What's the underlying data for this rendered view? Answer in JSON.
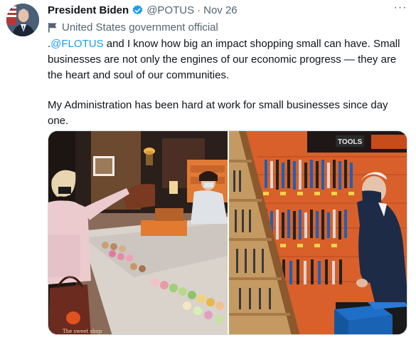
{
  "author": {
    "name": "President Biden",
    "handle": "@POTUS",
    "separator": "·",
    "date": "Nov 26",
    "label": "United States government official"
  },
  "tweet": {
    "prefix": ".",
    "mention": "@FLOTUS",
    "line1_rest": " and I know how big an impact shopping small can have. Small businesses are not only the engines of our economic progress — they are the heart and soul of our communities.",
    "line2": "My Administration has been hard at work for small businesses since day one."
  },
  "menu": {
    "more": "···"
  },
  "photos": {
    "bag_text": "The sweet shop",
    "store_sign": "TOOLS"
  },
  "colors": {
    "accent": "#1d9bf0",
    "secondary_text": "#536471",
    "border": "#cfd9de"
  }
}
